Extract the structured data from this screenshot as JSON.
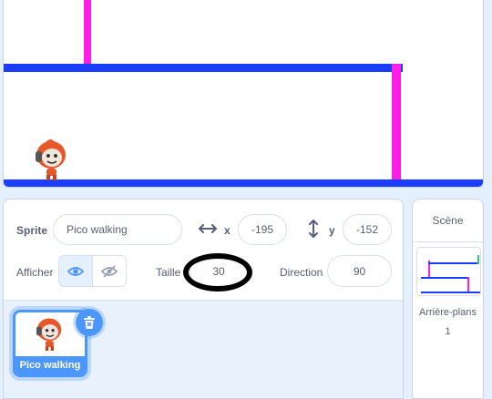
{
  "sprite_info": {
    "sprite_label": "Sprite",
    "sprite_name": "Pico walking",
    "x_label": "x",
    "x_value": "-195",
    "y_label": "y",
    "y_value": "-152",
    "show_label": "Afficher",
    "size_label": "Taille",
    "size_value": "30",
    "direction_label": "Direction",
    "direction_value": "90"
  },
  "sprite_list": {
    "items": [
      {
        "name": "Pico walking",
        "selected": true
      }
    ]
  },
  "stage_pane": {
    "title": "Scène",
    "backdrops_label": "Arrière-plans",
    "backdrops_count": "1"
  },
  "colors": {
    "accent": "#4c97ff",
    "stage_blue_line": "#1a3dff",
    "stage_pink_post": "#ff1ee6",
    "annotation_oval": "#000000"
  },
  "icons": {
    "horizontal_arrow": "left-right-arrow-icon",
    "vertical_arrow": "up-down-arrow-icon",
    "show": "eye-icon",
    "hide": "eye-slash-icon",
    "delete": "trash-icon"
  }
}
